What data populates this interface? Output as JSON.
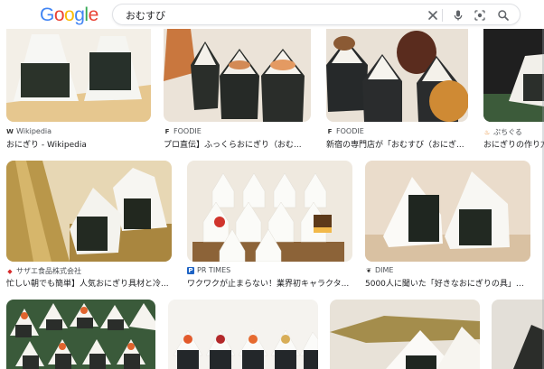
{
  "logo": {
    "letters": [
      "G",
      "o",
      "o",
      "g",
      "l",
      "e"
    ],
    "colors": [
      "#4285F4",
      "#EA4335",
      "#FBBC05",
      "#4285F4",
      "#34A853",
      "#EA4335"
    ]
  },
  "search": {
    "query": "おむすび"
  },
  "icons": {
    "clear": "close-icon",
    "voice": "microphone-icon",
    "lens": "camera-lens-icon",
    "search": "search-icon"
  },
  "results_row1": [
    {
      "source": "Wikipedia",
      "favicon": "W",
      "title": "おにぎり - Wikipedia"
    },
    {
      "source": "FOODIE",
      "favicon": "F",
      "title": "プロ直伝】ふっくらおにぎり（おむ..."
    },
    {
      "source": "FOODIE",
      "favicon": "F",
      "title": "新宿の専門店が「おむすび（おにぎ..."
    },
    {
      "source": "ぷちぐる",
      "favicon": "♨",
      "title": "おにぎりの作り方"
    }
  ],
  "results_row2": [
    {
      "source": "サザエ食品株式会社",
      "favicon": "◆",
      "title": "忙しい朝でも簡単】人気おにぎり具材と冷..."
    },
    {
      "source": "PR TIMES",
      "favicon": "P",
      "title": "ワクワクが止まらない！業界初キャラクタ..."
    },
    {
      "source": "DIME",
      "favicon": "❦",
      "title": "5000人に聞いた「好きなおにぎりの具」ラ..."
    }
  ]
}
